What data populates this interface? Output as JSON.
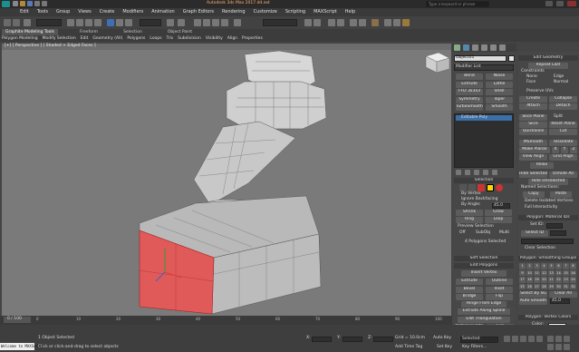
{
  "app": {
    "title": "Autodesk 3ds Max 2017.dd.ext",
    "search_placeholder": "Type a keyword or phrase"
  },
  "menubar": {
    "items": [
      "Edit",
      "Tools",
      "Group",
      "Views",
      "Create",
      "Modifiers",
      "Animation",
      "Graph Editors",
      "Rendering",
      "Customize",
      "Scripting",
      "MAXScript",
      "Help"
    ]
  },
  "ribbon": {
    "tabs": [
      "Graphite Modeling Tools",
      "Freeform",
      "Selection",
      "Object Paint"
    ],
    "subtabs": [
      "Polygon Modeling",
      "Modify Selection",
      "Edit",
      "Geometry (All)",
      "Polygons",
      "Loops",
      "Tris",
      "Subdivision",
      "Visibility",
      "Align",
      "Properties"
    ]
  },
  "viewport": {
    "label": "[+] [ Perspective ] [ Shaded + Edged Faces ]"
  },
  "command_panel": {
    "object_name": "Object01",
    "modifier_list": "Modifier List",
    "modifier_buttons": [
      "Bend",
      "Noise",
      "Extrude",
      "Lathe",
      "FFD 3x3x3",
      "Shell",
      "Symmetry",
      "Taper",
      "TurboSmooth",
      "Smooth"
    ],
    "stack_item": "Editable Poly",
    "selection_header": "Selection",
    "by_vertex": "By Vertex",
    "ignore_backfacing": "Ignore Backfacing",
    "by_angle": "By Angle:",
    "by_angle_value": "45.0",
    "shrink": "Shrink",
    "grow": "Grow",
    "ring": "Ring",
    "loop": "Loop",
    "preview_selection": "Preview Selection",
    "off": "Off",
    "subobj": "SubObj",
    "multi": "Multi",
    "polygons_selected": "4 Polygons Selected",
    "soft_selection": "Soft Selection",
    "edit_polygons": "Edit Polygons",
    "insert_vertex": "Insert Vertex",
    "edit_poly_buttons": [
      "Extrude",
      "Outline",
      "Bevel",
      "Inset",
      "Bridge",
      "Flip"
    ],
    "hinge": "Hinge From Edge",
    "extrude_spline": "Extrude Along Spline",
    "edit_triangulation": "Edit Triangulation",
    "retriangulate": "Retriangulate",
    "turn": "Turn"
  },
  "right_panel": {
    "edit_geometry": "Edit Geometry",
    "repeat_last": "Repeat Last",
    "constraints": "Constraints",
    "none": "None",
    "edge": "Edge",
    "face": "Face",
    "normal": "Normal",
    "preserve_uvs": "Preserve UVs",
    "create": "Create",
    "collapse": "Collapse",
    "attach": "Attach",
    "detach": "Detach",
    "slice_plane": "Slice Plane",
    "split": "Split",
    "slice": "Slice",
    "reset_plane": "Reset Plane",
    "quickslice": "QuickSlice",
    "cut": "Cut",
    "msmooth": "MSmooth",
    "tessellate": "Tessellate",
    "make_planar": "Make Planar",
    "x": "X",
    "y": "Y",
    "z": "Z",
    "view_align": "View Align",
    "grid_align": "Grid Align",
    "relax": "Relax",
    "hide_selected": "Hide Selected",
    "unhide_all": "Unhide All",
    "hide_unselected": "Hide Unselected",
    "named_selections": "Named Selections:",
    "copy": "Copy",
    "paste": "Paste",
    "delete_isolated": "Delete Isolated Vertices",
    "full_interactivity": "Full Interactivity",
    "material_ids": "Polygon: Material IDs",
    "set_id": "Set ID:",
    "select_id": "Select ID",
    "clear_selection": "Clear Selection",
    "smoothing_groups": "Polygon: Smoothing Groups",
    "sg_numbers": [
      "1",
      "2",
      "3",
      "4",
      "5",
      "6",
      "7",
      "8",
      "9",
      "10",
      "11",
      "12",
      "13",
      "14",
      "15",
      "16",
      "17",
      "18",
      "19",
      "20",
      "21",
      "22",
      "23",
      "24",
      "25",
      "26",
      "27",
      "28",
      "29",
      "30",
      "31",
      "32"
    ],
    "select_by_sg": "Select By SG",
    "clear_all": "Clear All",
    "auto_smooth": "Auto Smooth",
    "auto_smooth_value": "45.0",
    "vertex_colors": "Polygon: Vertex Colors",
    "color": "Color:"
  },
  "timeline": {
    "frame": "0 / 100",
    "ticks": [
      "0",
      "10",
      "20",
      "30",
      "40",
      "50",
      "60",
      "70",
      "80",
      "90",
      "100"
    ]
  },
  "status": {
    "script_label": "Welcome to MAXScript.",
    "objects_selected": "1 Object Selected",
    "prompt": "Click or click-and-drag to select objects",
    "x": "X:",
    "y": "Y:",
    "z": "Z:",
    "grid": "Grid = 10.0cm",
    "add_time_tag": "Add Time Tag",
    "auto_key": "Auto Key",
    "selected": "Selected",
    "set_key": "Set Key",
    "key_filters": "Key Filters..."
  },
  "colors": {
    "accent_red": "#e05a5a",
    "selection_red": "#cc2a2a",
    "panel": "#474747",
    "viewport": "#7a7a7a"
  }
}
